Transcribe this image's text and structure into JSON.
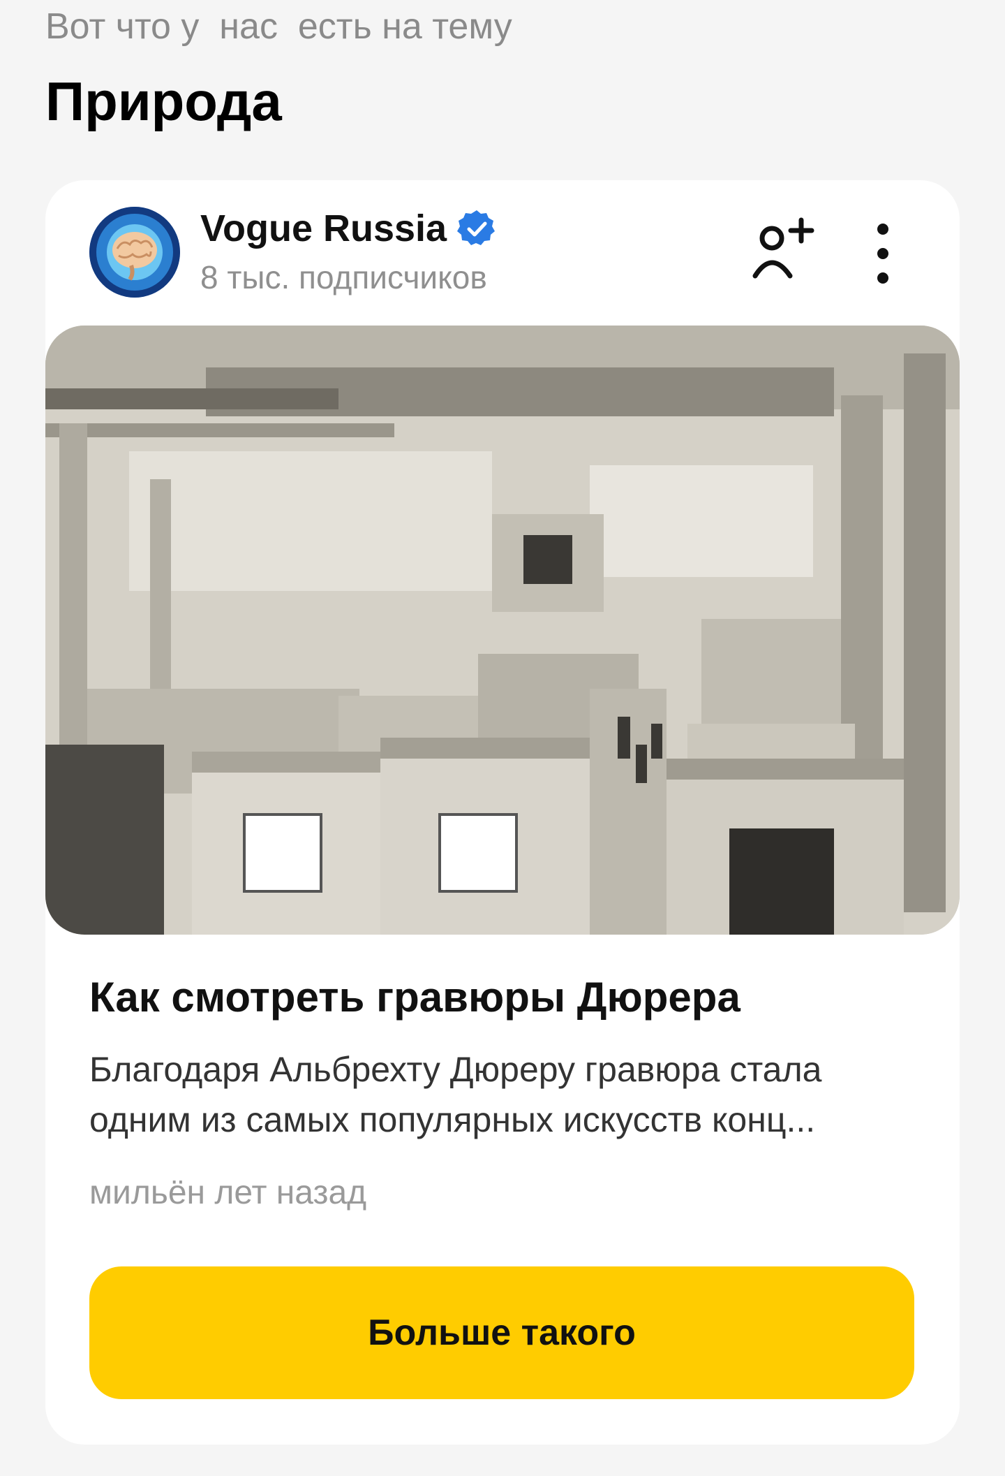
{
  "header": {
    "intro": "Вот что у  нас  есть на тему",
    "topic": "Природа"
  },
  "card": {
    "channel": {
      "name": "Vogue Russia",
      "verified": true,
      "subscribers": "8 тыс. подписчиков",
      "avatar_icon": "brain-avatar",
      "subscribe_icon": "add-person-icon",
      "more_icon": "more-vertical-icon"
    },
    "cover_image": "factory-hall-photo",
    "article": {
      "title": "Как смотреть гравюры Дюрера",
      "snippet": "Благодаря Альбрехту Дюреру гравюра стала одним из самых популярных искусств конц...",
      "time": "мильён лет назад"
    },
    "cta": {
      "label": "Больше такого",
      "color": "#ffcc00"
    }
  },
  "colors": {
    "background": "#f5f5f5",
    "card": "#ffffff",
    "verified": "#2a7be4",
    "muted_text": "#8f8f8f"
  }
}
